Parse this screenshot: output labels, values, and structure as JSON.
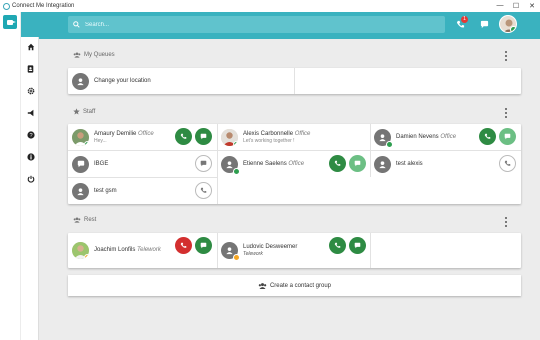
{
  "window": {
    "title": "Connect Me Integration",
    "min": "—",
    "max": "☐",
    "close": "✕"
  },
  "search": {
    "placeholder": "Search..."
  },
  "topbar": {
    "missed_calls": "1"
  },
  "nav": [
    "home-icon",
    "contacts-icon",
    "settings-icon",
    "announcement-icon",
    "help-icon",
    "info-icon",
    "power-icon"
  ],
  "queues": {
    "title": "My Queues",
    "items": [
      {
        "label": "Change your location"
      }
    ]
  },
  "staff": {
    "title": "Staff",
    "members": [
      {
        "name": "Amaury Demilie",
        "location": "Office",
        "status": "Hey..."
      },
      {
        "name": "Alexis Carbonnelle",
        "location": "Office",
        "status": "Let's working together !"
      },
      {
        "name": "Damien Nevens",
        "location": "Office"
      },
      {
        "name": "IBGE"
      },
      {
        "name": "Etienne Saelens",
        "location": "Office"
      },
      {
        "name": "test alexis"
      },
      {
        "name": "test gsm"
      }
    ]
  },
  "rest": {
    "title": "Rest",
    "members": [
      {
        "name": "Joachim Lonfils",
        "location": "Telework"
      },
      {
        "name": "Ludovic Desweemer",
        "location": "Telework"
      }
    ]
  },
  "create_group": {
    "label": "Create a contact group"
  },
  "colors": {
    "teal": "#3ab2bf",
    "green": "#2e8b43",
    "red": "#d32f2f",
    "orange": "#f5a623"
  }
}
